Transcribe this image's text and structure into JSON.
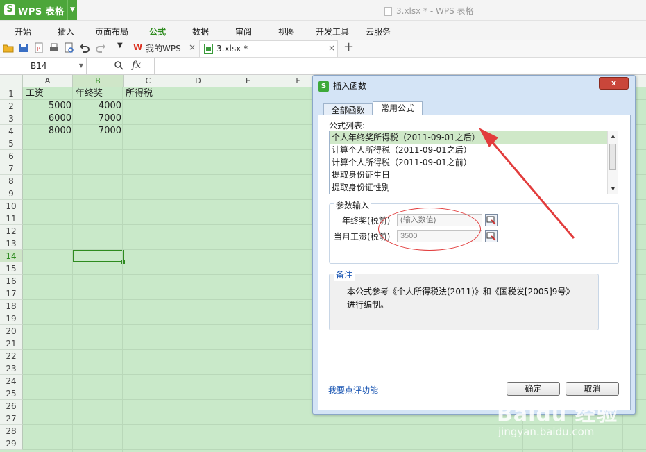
{
  "app": {
    "name": "WPS 表格",
    "logo_letter": "S",
    "window_title": "3.xlsx * - WPS 表格"
  },
  "menu": [
    "开始",
    "插入",
    "页面布局",
    "公式",
    "数据",
    "审阅",
    "视图",
    "开发工具",
    "云服务"
  ],
  "menu_active": "公式",
  "tabs": {
    "home_tab": "我的WPS",
    "file_tab": "3.xlsx *",
    "close": "×",
    "add": "+"
  },
  "formula_bar": {
    "cell_ref": "B14",
    "fx": "fx",
    "value": ""
  },
  "sheet": {
    "columns": [
      "A",
      "B",
      "C",
      "D",
      "E",
      "F"
    ],
    "selected_col": "B",
    "rows": [
      "1",
      "2",
      "3",
      "4",
      "5",
      "6",
      "7",
      "8",
      "9",
      "10",
      "11",
      "12",
      "13",
      "14",
      "15",
      "16",
      "17",
      "18",
      "19",
      "20",
      "21",
      "22",
      "23",
      "24",
      "25",
      "26",
      "27",
      "28",
      "29"
    ],
    "selected_row": "14",
    "cells": {
      "A1": "工资",
      "B1": "年终奖",
      "C1": "所得税",
      "A2": "5000",
      "B2": "4000",
      "A3": "6000",
      "B3": "7000",
      "A4": "8000",
      "B4": "7000"
    }
  },
  "dialog": {
    "title": "插入函数",
    "close_label": "x",
    "tabs": [
      "全部函数",
      "常用公式"
    ],
    "active_tab": "常用公式",
    "list_label": "公式列表:",
    "formulas": [
      "个人年终奖所得税（2011-09-01之后）",
      "计算个人所得税（2011-09-01之后）",
      "计算个人所得税（2011-09-01之前）",
      "提取身份证生日",
      "提取身份证性别"
    ],
    "selected_formula_index": 0,
    "param_group_title": "参数输入",
    "params": [
      {
        "label": "年终奖(税前)",
        "value": "",
        "placeholder": "(输入数值)"
      },
      {
        "label": "当月工资(税前)",
        "value": "3500",
        "placeholder": ""
      }
    ],
    "note_title": "备注",
    "note_line1": "本公式参考《个人所得税法(2011)》和《国税发[2005]9号》",
    "note_line2": "进行编制。",
    "feedback_link": "我要点评功能",
    "ok_label": "确定",
    "cancel_label": "取消"
  },
  "watermark": {
    "line1": "Baidu 经验",
    "line2": "jingyan.baidu.com"
  },
  "colors": {
    "brand_green": "#4ca63a",
    "grid_bg": "#c9e9c9",
    "annotation_red": "#e23c3c",
    "link_blue": "#1a56b3"
  }
}
